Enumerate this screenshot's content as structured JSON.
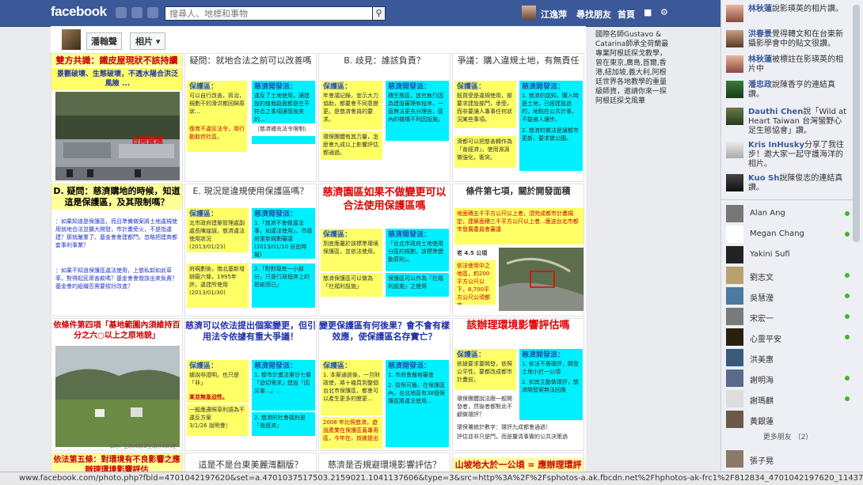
{
  "topbar": {
    "logo": "facebook",
    "search_placeholder": "搜尋人、地標和事物",
    "user_name": "江逸萍",
    "find_friends": "尋找朋友",
    "home": "首頁"
  },
  "profile": {
    "name": "潘翰聲",
    "tab": "相片"
  },
  "grid": {
    "t1_title": "雙方共識：鐵皮屋現狀不該持續",
    "t1_sub": "景觀破壞、生態破壞，不透水陽合洪泛風險 ...",
    "t1_caption": "台開營建",
    "t2_title": "疑問：就地合法之前可以改善嗎",
    "t2_a_hd": "保護區：",
    "t2_a": "可以自行改善，拆治，規劃干的滑洪都回歸原狀...",
    "t2_a2": "復育不違反法令，用行動取信社區。",
    "t2_b_hd": "慈濟開發派：",
    "t2_b": "違反了土地使用，讓建設的植栽路面都是在不符合之事項讓我後來的...",
    "t2_b2": "（慈濟補充法令限制）",
    "t3_title": "B. 歧見：誰該負責？",
    "t3_a_hd": "保護區：",
    "t3_a": "年會議記錄，宣示大力協助，都要會不同意變更。是慈濟會員的要求。",
    "t3_a2": "環保團體有其力量，怎麼會九成以上影響評估都通過。",
    "t3_b_hd": "慈濟開發派：",
    "t3_b": "積生態區，追究執行因為建設審理有程序，一直無法更充分理由，區內的機構不利因設施。",
    "t4_title": "爭議：購入違規土地，有無責任",
    "t4_a_hd": "保護區：",
    "t4_a": "既買受是違規使用，部要求建設部門，承受，而非要讓人專事任何狀況某些事項。",
    "t4_a2": "滑都可以把慈善轉作為「善經濟」，使用濕源做強化，衝突。",
    "t4_b_hd": "慈濟開發派：",
    "t4_b": "1. 慈濟的認知，購入時是土地，已經建設過的，地點在公共計事，不能被人讓步。",
    "t4_b2": "2. 慈濟的做法是讓都市更新，要求做公園。",
    "t5_title": "D. 疑問：慈濟購地的時候，知道這是保護區，及其限制嗎？",
    "t5_a": "：如果知道是保護區，而且準備做案將土地違規使用就地合法並擴大開發，市計畫旁火，不是指違建？那就嚴重了。基金會會建都門，忽略把建商都套事利事業？",
    "t5_b": "：如果不知道保護區違法使用，上慈私卸如此草率，對得起民眾善款嗎？基金會會撥該出來負責？基金會的組織否需要檢討改進？",
    "t6_title": "E. 現況是違規使用保護區嗎？",
    "t6_a_hd": "保護區：",
    "t6_a": "北市政府建築管理處副處長陳煌誠，慈濟違法使用狀況",
    "t6_a_date": "(2013/01/23)",
    "t6_a2": "府規劃後，南北基新增辦廠六條，1995年許，違建所使用",
    "t6_a2_date": "(2013/01/30)",
    "t6_b_hd": "慈濟開發派：",
    "t6_b": "1.「慈濟不會做違法事，如違法使用」，市政府重新規劃審議",
    "t6_b_date": "(2013/01/10 自由時報)",
    "t6_b2": "2.「對對現有一小部分，只是行政程序上的瑕疵而已」",
    "t7_title": "慈濟園區如果不做變更可以合法使用保護區嗎",
    "t7_a_hd": "保護區：",
    "t7_a": "到底應屬於該標準環境保護區，並依法使用。",
    "t7_a2": "慈濟保護區可以做為「社福利設施」",
    "t7_b_hd": "慈濟開發派：",
    "t7_b": "「台北市政府土地使用分區的規劃，該標準變動原則」。",
    "t7_b2": "保護區可以作為「社福利設施」之使用",
    "t8_title": "條件第七項，關於開發面積",
    "t8_a": "地面積五千平方公尺以上者，須完成都市計畫規定，建築面積三千平方公尺以上者...應送台北市都市發展委員會審議",
    "t8_area": "老 4.5 公頃",
    "t8_b": "依法使用中之地區，約200平方公尺以下，8,700平方公尺公頃都市...",
    "t9_title": "依條件第四項「基地範圍內須維持百分之六○以上之原地貌」",
    "t9_caption": "佔地：生態與慈濟空間分佈的理念",
    "t10_title": "慈濟可以依法提出個案變更，但引用法令依據有重大爭議！",
    "t10_a_hd": "保護區：",
    "t10_a": "據說非證明，也只是「非」",
    "t10_a2": "某並無急迫性。",
    "t10_a3": "一般應遵照草利語為不違反方案",
    "t10_a_date": "3/1/26 說明會）",
    "t10_b_hd": "慈濟開發派：",
    "t10_b": "1. 都市計畫法第廿七條「迫切需求」建設「因災害...」...",
    "t10_b2": "2. 慈濟的社會福利是「善經濟」",
    "t11_title": "變更保護區有何後果？會不會有樣效應，使保護區名存實亡？",
    "t11_a_hd": "保護區：",
    "t11_a": "1. 本案通過後，一旦財政使，將十幾頁到整個台北市保護區，都會可以產生更多的變更...",
    "t11_a2": "2008 年比照慈濟，遊說產業在保護區蓋專用區，今年在，就被提出",
    "t11_b_hd": "慈濟開發派：",
    "t11_b": "1. 市府會嚴格審查",
    "t11_b2": "2. 前例可循，在保護區內，台北地區有38個保護區將違法使用...",
    "t12_title": "該辦理環境影響評估嗎",
    "t12_a_hd": "保護區：",
    "t12_a": "依據要求要開發，依照公平性，要都改成都市計畫前，",
    "t12_b_hd": "慈濟開發派：",
    "t12_b": "1. 依法不需環評，開發土地小於一公頃",
    "t12_b2": "2. 如其主動做環評，慈濟開發案無法回應",
    "t12_c": "環保團體說法跟一般開發者，然後者都對此不顧做環評？",
    "t12_d": "環保署統計數字：環評九成都會通過！",
    "t12_e": "評估並非只是門，而是釐清事實的公共決策過",
    "t13_title": "依法第五條：對環境有不良影響之應辦理環境影響評估",
    "t14_title": "這是不是台東美麗灣翻版？",
    "t15_title": "慈濟是否規避環境影響評估？",
    "t16_title": "山坡地大於一公頃 = 應辦理環評"
  },
  "ticker": "國際名師Gustavo & Catarina師承全荷蘭最專業阿根廷探戈教學，曾在東京,廣島,首爾,香港,紐加坡,義大利,阿根廷世界各地教學的重量級師資，邀請你來一探阿根廷探戈風華",
  "sidebar": {
    "feed": [
      {
        "name": "林秋蓮",
        "text": "說影瑛英的相片讚。"
      },
      {
        "name": "洪春景",
        "text": "覺得轉文和在台東新攝影學會中的貼文很讚。"
      },
      {
        "name": "林秋蓮",
        "text": "被標註在影瑛英的相片中"
      },
      {
        "name": "潘忠政",
        "text": "說陳香亨的連結真讚。"
      },
      {
        "name": "Dauthi Chen",
        "text": "說「Wild at Heart Taiwan 台灣蠻野心足生態協會」讚。"
      },
      {
        "name": "Kris InHusky",
        "text": "分享了我往步！邀大家一起守護海洋的相片。"
      },
      {
        "name": "Kuo Sh",
        "text": "說陳俊志的連結真讚。"
      }
    ],
    "chat": [
      {
        "name": "Alan Ang",
        "online": true
      },
      {
        "name": "Megan Chang",
        "online": true
      },
      {
        "name": "Yakini Sufi",
        "online": false
      },
      {
        "name": "劉志文",
        "online": true
      },
      {
        "name": "吳慧瀅",
        "online": true
      },
      {
        "name": "宋宏一",
        "online": true
      },
      {
        "name": "心靈平安",
        "online": true
      },
      {
        "name": "洪美惠",
        "online": false
      },
      {
        "name": "謝明海",
        "online": true
      },
      {
        "name": "謝瑪麒",
        "online": true
      },
      {
        "name": "黃銀蓮",
        "online": false
      }
    ],
    "more_friends": "更多朋友 （2）",
    "bottom_friend": "張子晃"
  },
  "status_url": "www.facebook.com/photo.php?fbid=4701042197620&set=a.4701037517503.2159021.1041137606&type=3&src=http%3A%2F%2Fsphotos-a.ak.fbcdn.net%2Fhphotos-ak-frc1%2F812834_4701042197620_1143712858_o.jpg&smallsrc..."
}
